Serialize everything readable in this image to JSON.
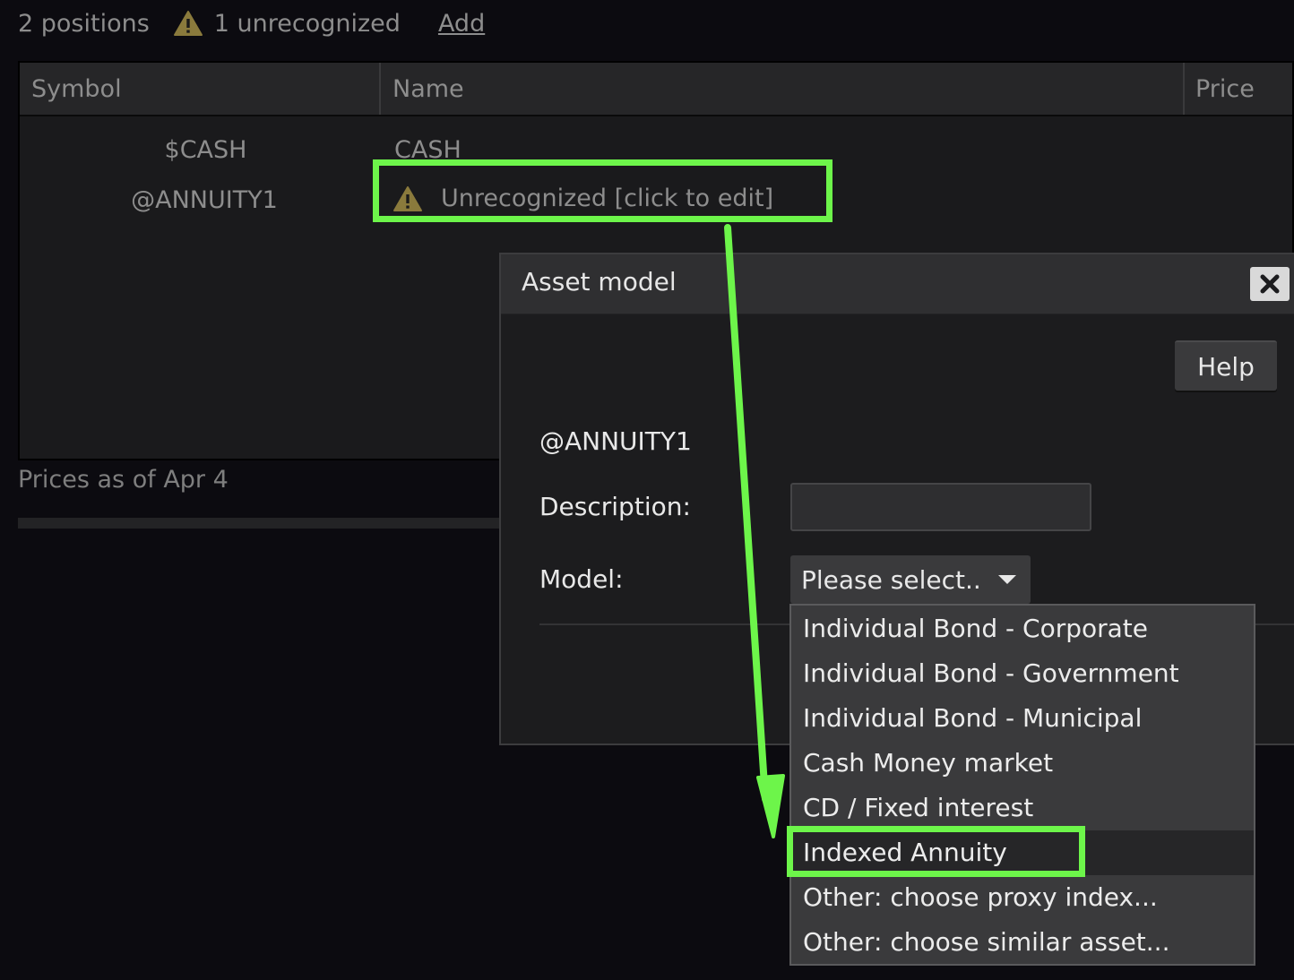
{
  "summary": {
    "positions": "2 positions",
    "unrecognized": "1 unrecognized",
    "add_label": "Add"
  },
  "table": {
    "columns": [
      "Symbol",
      "Name",
      "Price"
    ],
    "rows": [
      {
        "symbol": "$CASH",
        "name": "CASH"
      },
      {
        "symbol": "@ANNUITY1",
        "name": "Unrecognized [click to edit]"
      }
    ],
    "prices_note": "Prices as of Apr 4"
  },
  "dialog": {
    "title": "Asset model",
    "close_glyph": "✖",
    "help_label": "Help",
    "asset_symbol": "@ANNUITY1",
    "description_label": "Description:",
    "description_value": "",
    "model_label": "Model:",
    "model_selected": "Please select.."
  },
  "dropdown": {
    "options": [
      "Individual Bond - Corporate",
      "Individual Bond - Government",
      "Individual Bond - Municipal",
      "Cash Money market",
      "CD / Fixed interest",
      "Indexed Annuity",
      "Other: choose proxy index...",
      "Other: choose similar asset..."
    ],
    "highlighted": "Indexed Annuity"
  },
  "colors": {
    "annotation": "#6df54a",
    "warning": "#8a7a3c",
    "background": "#0c0b10"
  },
  "icons": {
    "warning": "warning-triangle-icon",
    "close": "close-x-icon",
    "caret": "caret-down-icon"
  }
}
